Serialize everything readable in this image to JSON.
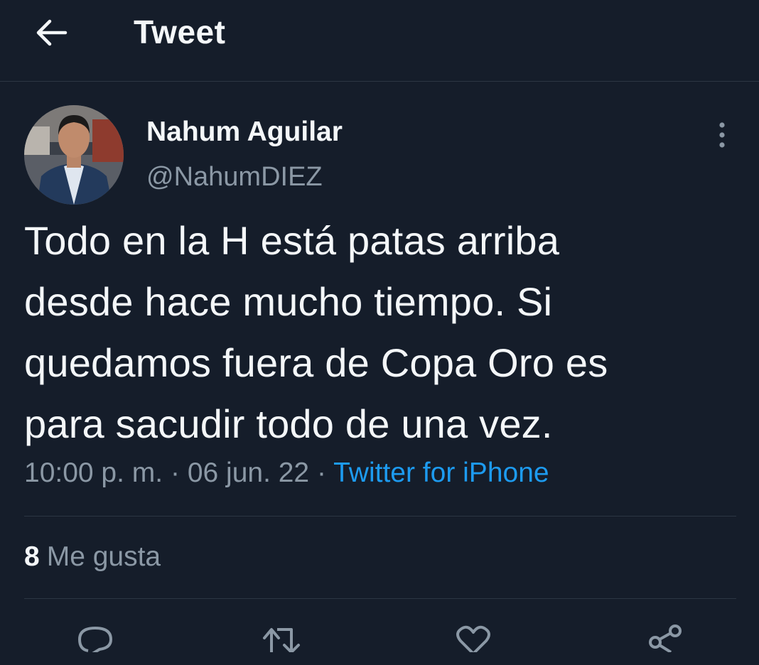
{
  "header": {
    "title": "Tweet",
    "back_icon": "arrow-left-icon"
  },
  "tweet": {
    "author": {
      "display_name": "Nahum Aguilar",
      "handle": "@NahumDIEZ"
    },
    "text_lines": [
      "Todo en la H está patas arriba",
      "desde hace mucho tiempo. Si",
      "quedamos fuera de Copa Oro es",
      "para sacudir todo de una vez."
    ],
    "time": "10:00 p. m.",
    "separator": "·",
    "date": "06 jun. 22",
    "source": "Twitter for iPhone",
    "likes_count": "8",
    "likes_label": "Me gusta"
  },
  "actions": [
    "reply-icon",
    "retweet-icon",
    "like-icon",
    "share-icon"
  ],
  "colors": {
    "background": "#151d2a",
    "text": "#f4f7f9",
    "secondary": "#8b98a5",
    "link": "#1d9bf0",
    "divider": "#2c3643"
  }
}
